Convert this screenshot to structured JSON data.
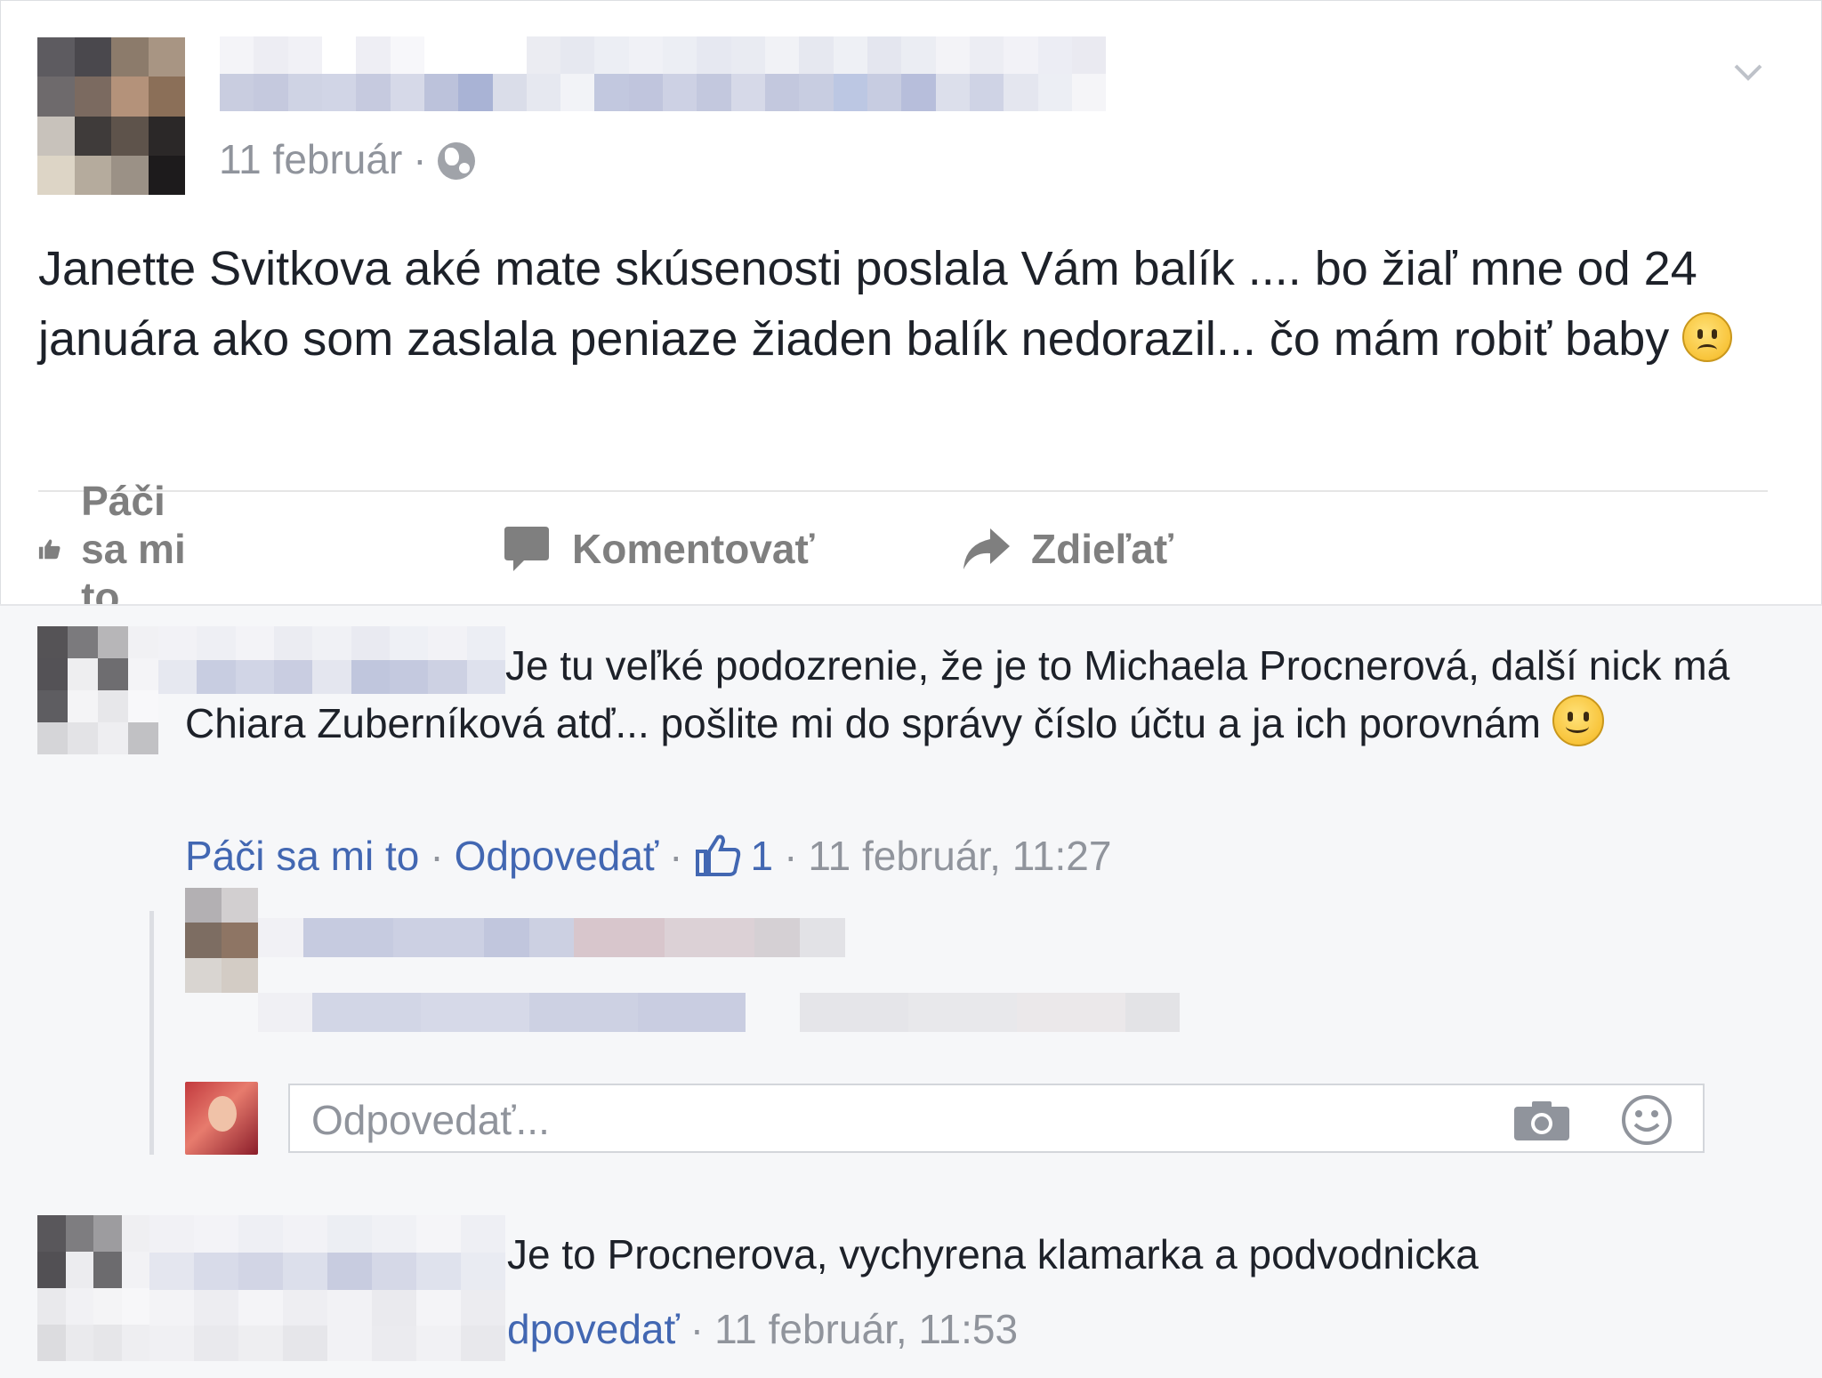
{
  "post": {
    "date": "11 február",
    "separator": "·",
    "text_main": "Janette Svitkova aké mate skúsenosti poslala Vám balík .... bo žiaľ mne od 24 januára ako som zaslala peniaze žiaden balík nedorazil... čo mám robiť baby ",
    "text_emoji": "sad-face-emoji"
  },
  "actions": {
    "like_label": "Páči sa mi to",
    "comment_label": "Komentovať",
    "share_label": "Zdieľať"
  },
  "comments": [
    {
      "text": "Je tu veľké podozrenie, že je to Michaela Procnerová, další nick má Chiara Zuberníková atď... pošlite mi do správy číslo účtu a ja ich porovnám ",
      "text_emoji": "smile-emoji",
      "like_label": "Páči sa mi to",
      "reply_label": "Odpovedať",
      "like_count": "1",
      "timestamp": "11 február, 11:27",
      "separator": "·"
    },
    {
      "text": "Je to Procnerova, vychyrena klamarka a podvodnicka",
      "reply_label": "dpovedať",
      "timestamp": "11 február, 11:53",
      "separator": "·"
    }
  ],
  "reply_input": {
    "placeholder": "Odpovedať..."
  },
  "colors": {
    "link": "#4267b2",
    "meta": "#90949c",
    "text": "#1d2129",
    "comment_bg": "#f6f7f9"
  },
  "icons": [
    "globe-icon",
    "chevron-down-icon",
    "like-icon",
    "comment-icon",
    "share-icon",
    "thumbs-up-icon",
    "camera-icon",
    "smile-icon"
  ]
}
